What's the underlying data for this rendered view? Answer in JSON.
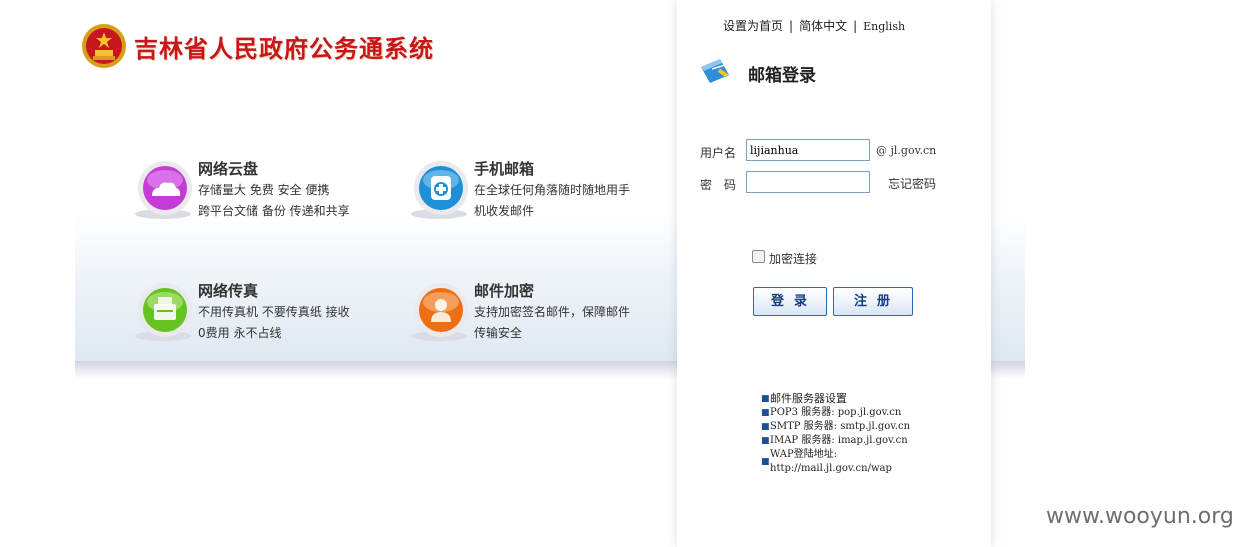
{
  "header": {
    "site_title": "吉林省人民政府公务通系统"
  },
  "top_links": {
    "set_home": "设置为首页",
    "separator": "|",
    "simplified_chinese": "简体中文",
    "english": "English"
  },
  "features": [
    {
      "title": "网络云盘",
      "desc_line1": "存储量大 免费 安全 便携",
      "desc_line2": "跨平台文储 备份 传递和共享",
      "icon": "cloud-icon",
      "color": "#c43bd6"
    },
    {
      "title": "手机邮箱",
      "desc_line1": "在全球任何角落随时随地用手",
      "desc_line2": "机收发邮件",
      "icon": "mobile-mail-icon",
      "color": "#1f8fd8"
    },
    {
      "title": "网络传真",
      "desc_line1": "不用传真机 不要传真纸 接收",
      "desc_line2": "0费用 永不占线",
      "icon": "fax-icon",
      "color": "#66c21f"
    },
    {
      "title": "邮件加密",
      "desc_line1": "支持加密签名邮件，保障邮件",
      "desc_line2": "传输安全",
      "icon": "encrypt-mail-icon",
      "color": "#ef6e12"
    }
  ],
  "login": {
    "title": "邮箱登录",
    "username_label": "用户名",
    "username_value": "lijianhua",
    "domain_suffix": "@ jl.gov.cn",
    "password_label": "密　码",
    "password_value": "",
    "forgot_password": "忘记密码",
    "secure_connection_label": "加密连接",
    "secure_connection_checked": false,
    "login_button": "登录",
    "register_button": "注册"
  },
  "server_info": {
    "heading": "邮件服务器设置",
    "pop3": "POP3 服务器: pop.jl.gov.cn",
    "smtp": "SMTP 服务器: smtp.jl.gov.cn",
    "imap": "IMAP 服务器: imap.jl.gov.cn",
    "wap_label": "WAP登陆地址:",
    "wap_url": "http://mail.jl.gov.cn/wap"
  },
  "watermark": "www.wooyun.org",
  "colors": {
    "title_red": "#c8161d",
    "button_text": "#163f7a",
    "button_border": "#2e6aa8",
    "input_border": "#7f9db9"
  }
}
